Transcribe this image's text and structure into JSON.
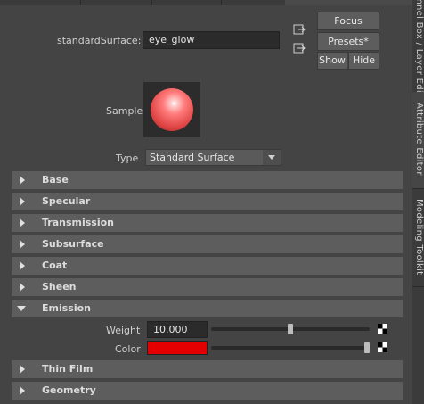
{
  "window": {
    "side_tabs": [
      "Channel Box / Layer Editor",
      "Attribute Editor",
      "Modeling Toolkit"
    ]
  },
  "header": {
    "node_type_label": "standardSurface:",
    "node_name": "eye_glow",
    "focus_label": "Focus",
    "presets_label": "Presets*",
    "show_label": "Show",
    "hide_label": "Hide"
  },
  "sample": {
    "label": "Sample"
  },
  "type": {
    "label": "Type",
    "value": "Standard Surface"
  },
  "sections": {
    "base": "Base",
    "specular": "Specular",
    "transmission": "Transmission",
    "subsurface": "Subsurface",
    "coat": "Coat",
    "sheen": "Sheen",
    "emission": "Emission",
    "thin_film": "Thin Film",
    "geometry": "Geometry"
  },
  "emission": {
    "weight_label": "Weight",
    "weight_value": "10.000",
    "weight_slider_fraction": 0.5,
    "color_label": "Color",
    "color_hex": "#e40000",
    "color_slider_fraction": 1.0
  },
  "colors": {
    "panel_bg": "#444444",
    "section_bg": "#5d5d5d",
    "field_bg": "#2b2b2b",
    "emission_color": "#e40000"
  }
}
